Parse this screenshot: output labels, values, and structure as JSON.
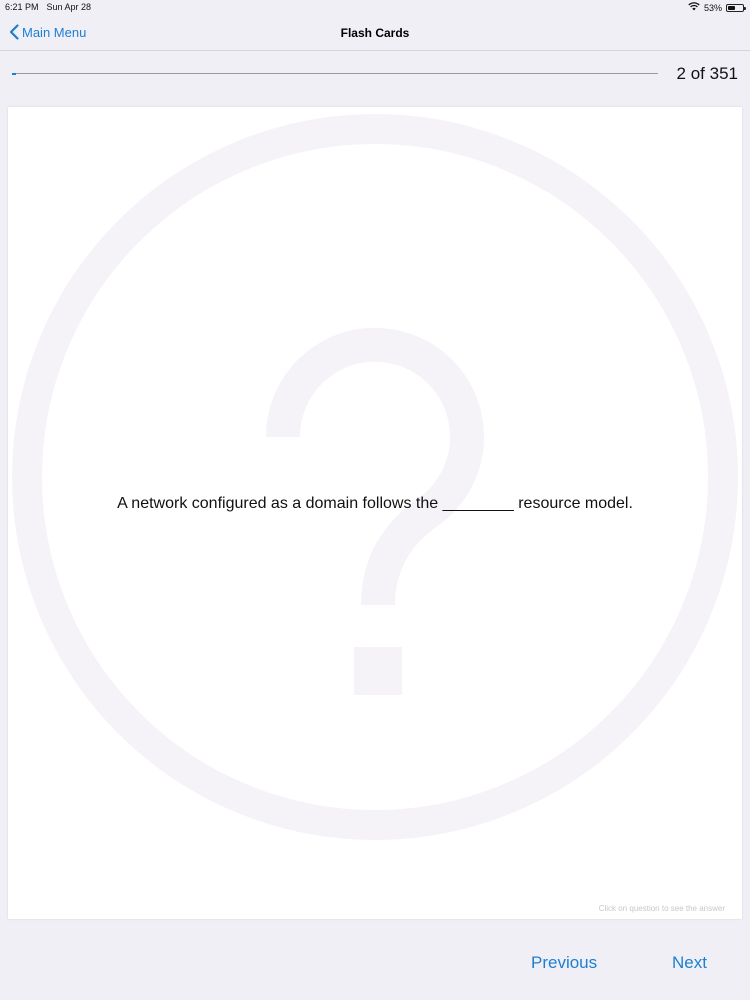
{
  "status_bar": {
    "time": "6:21 PM",
    "date": "Sun Apr 28",
    "battery_text": "53%",
    "battery_level": 0.53,
    "wifi_icon": "wifi-icon",
    "battery_icon": "battery-icon"
  },
  "nav": {
    "back_label": "Main Menu",
    "back_icon": "chevron-left-icon",
    "title": "Flash Cards"
  },
  "progress": {
    "current": 2,
    "total": 351,
    "label": "2 of 351"
  },
  "card": {
    "question": "A network configured as a domain follows the ________ resource model.",
    "hint": "Click on question to see the answer",
    "watermark_icon": "question-mark-icon"
  },
  "footer": {
    "previous_label": "Previous",
    "next_label": "Next"
  },
  "colors": {
    "accent": "#1e7fd2",
    "background": "#f0eff5",
    "card": "#ffffff",
    "watermark": "#f5f3f8"
  }
}
